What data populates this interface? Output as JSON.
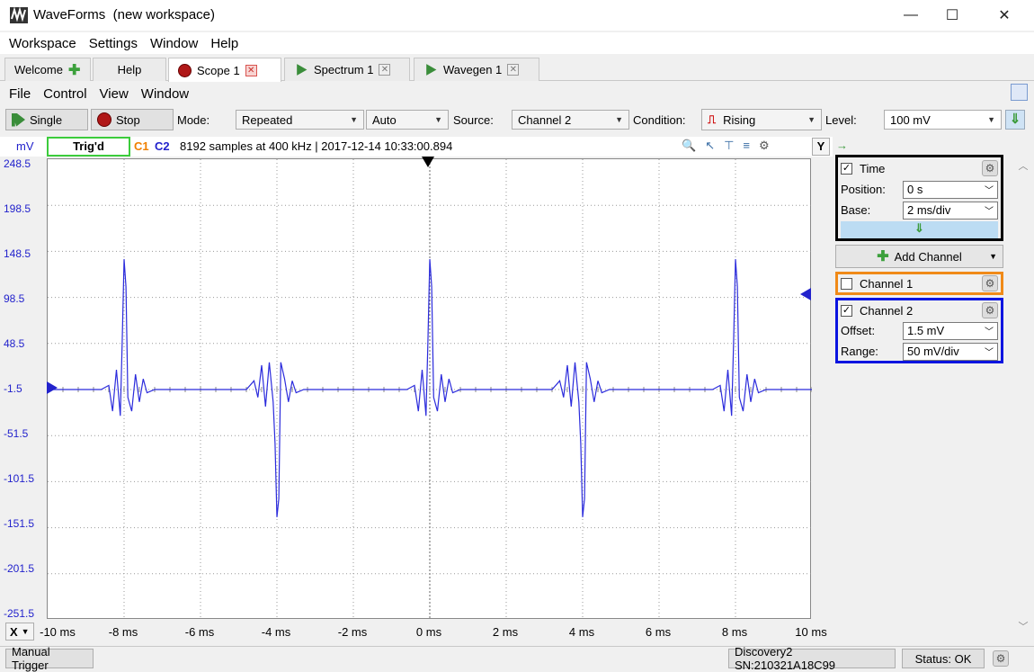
{
  "window": {
    "app_name": "WaveForms",
    "workspace": "(new workspace)",
    "minimize": "—",
    "maximize": "☐",
    "close": "✕"
  },
  "menu": [
    "Workspace",
    "Settings",
    "Window",
    "Help"
  ],
  "tabs": [
    {
      "label": "Welcome"
    },
    {
      "label": "Help"
    },
    {
      "label": "Scope 1"
    },
    {
      "label": "Spectrum 1"
    },
    {
      "label": "Wavegen 1"
    }
  ],
  "submenu": [
    "File",
    "Control",
    "View",
    "Window"
  ],
  "toolbar": {
    "single": "Single",
    "stop": "Stop",
    "mode_label": "Mode:",
    "mode_value": "Repeated",
    "auto_value": "Auto",
    "source_label": "Source:",
    "source_value": "Channel 2",
    "condition_label": "Condition:",
    "condition_value": "Rising",
    "level_label": "Level:",
    "level_value": "100 mV"
  },
  "plot_header": {
    "unit": "mV",
    "trig_status": "Trig'd",
    "c1": "C1",
    "c2": "C2",
    "info": "8192 samples at 400 kHz | 2017-12-14 10:33:00.894",
    "y_btn": "Y"
  },
  "y_ticks": [
    "248.5",
    "198.5",
    "148.5",
    "98.5",
    "48.5",
    "-1.5",
    "-51.5",
    "-101.5",
    "-151.5",
    "-201.5",
    "-251.5"
  ],
  "x_axis": {
    "button": "X",
    "ticks": [
      "-10 ms",
      "-8 ms",
      "-6 ms",
      "-4 ms",
      "-2 ms",
      "0 ms",
      "2 ms",
      "4 ms",
      "6 ms",
      "8 ms",
      "10 ms"
    ]
  },
  "chart_data": {
    "type": "line",
    "xlabel": "",
    "ylabel": "mV",
    "xlim": [
      -10,
      10
    ],
    "ylim": [
      -251.5,
      248.5
    ],
    "series": [
      {
        "color": "#2b2bdc",
        "points": [
          [
            -10,
            -1.5
          ],
          [
            -8.6,
            -1.5
          ],
          [
            -8.4,
            3
          ],
          [
            -8.3,
            -25
          ],
          [
            -8.2,
            20
          ],
          [
            -8.1,
            -30
          ],
          [
            -8.05,
            50
          ],
          [
            -8.0,
            140
          ],
          [
            -7.95,
            110
          ],
          [
            -7.9,
            -10
          ],
          [
            -7.8,
            -25
          ],
          [
            -7.7,
            15
          ],
          [
            -7.6,
            -15
          ],
          [
            -7.5,
            10
          ],
          [
            -7.4,
            -5
          ],
          [
            -7.2,
            -1.5
          ],
          [
            -4.8,
            -1.5
          ],
          [
            -4.6,
            8
          ],
          [
            -4.5,
            -10
          ],
          [
            -4.4,
            25
          ],
          [
            -4.3,
            -20
          ],
          [
            -4.2,
            28
          ],
          [
            -4.1,
            -15
          ],
          [
            -4.05,
            -60
          ],
          [
            -4.0,
            -140
          ],
          [
            -3.95,
            -120
          ],
          [
            -3.9,
            28
          ],
          [
            -3.8,
            10
          ],
          [
            -3.7,
            -15
          ],
          [
            -3.6,
            8
          ],
          [
            -3.5,
            -5
          ],
          [
            -3.3,
            -1.5
          ],
          [
            -0.6,
            -1.5
          ],
          [
            -0.4,
            3
          ],
          [
            -0.3,
            -25
          ],
          [
            -0.2,
            20
          ],
          [
            -0.1,
            -30
          ],
          [
            -0.05,
            50
          ],
          [
            0.0,
            140
          ],
          [
            0.05,
            110
          ],
          [
            0.1,
            -10
          ],
          [
            0.2,
            -25
          ],
          [
            0.3,
            15
          ],
          [
            0.4,
            -15
          ],
          [
            0.5,
            10
          ],
          [
            0.6,
            -5
          ],
          [
            0.8,
            -1.5
          ],
          [
            3.2,
            -1.5
          ],
          [
            3.4,
            8
          ],
          [
            3.5,
            -10
          ],
          [
            3.6,
            25
          ],
          [
            3.7,
            -20
          ],
          [
            3.8,
            28
          ],
          [
            3.9,
            -15
          ],
          [
            3.95,
            -60
          ],
          [
            4.0,
            -140
          ],
          [
            4.05,
            -120
          ],
          [
            4.1,
            28
          ],
          [
            4.2,
            10
          ],
          [
            4.3,
            -15
          ],
          [
            4.4,
            8
          ],
          [
            4.5,
            -5
          ],
          [
            4.7,
            -1.5
          ],
          [
            7.4,
            -1.5
          ],
          [
            7.6,
            3
          ],
          [
            7.7,
            -25
          ],
          [
            7.8,
            20
          ],
          [
            7.9,
            -30
          ],
          [
            7.95,
            50
          ],
          [
            8.0,
            140
          ],
          [
            8.05,
            110
          ],
          [
            8.1,
            -10
          ],
          [
            8.2,
            -25
          ],
          [
            8.3,
            15
          ],
          [
            8.4,
            -15
          ],
          [
            8.5,
            10
          ],
          [
            8.6,
            -5
          ],
          [
            8.8,
            -1.5
          ],
          [
            10,
            -1.5
          ]
        ]
      }
    ]
  },
  "time_panel": {
    "title": "Time",
    "position_label": "Position:",
    "position_value": "0 s",
    "base_label": "Base:",
    "base_value": "2 ms/div"
  },
  "add_channel": "Add Channel",
  "channel1": {
    "title": "Channel 1"
  },
  "channel2": {
    "title": "Channel 2",
    "offset_label": "Offset:",
    "offset_value": "1.5 mV",
    "range_label": "Range:",
    "range_value": "50 mV/div"
  },
  "status": {
    "manual_trigger": "Manual Trigger",
    "device": "Discovery2 SN:210321A18C99",
    "status": "Status: OK"
  }
}
